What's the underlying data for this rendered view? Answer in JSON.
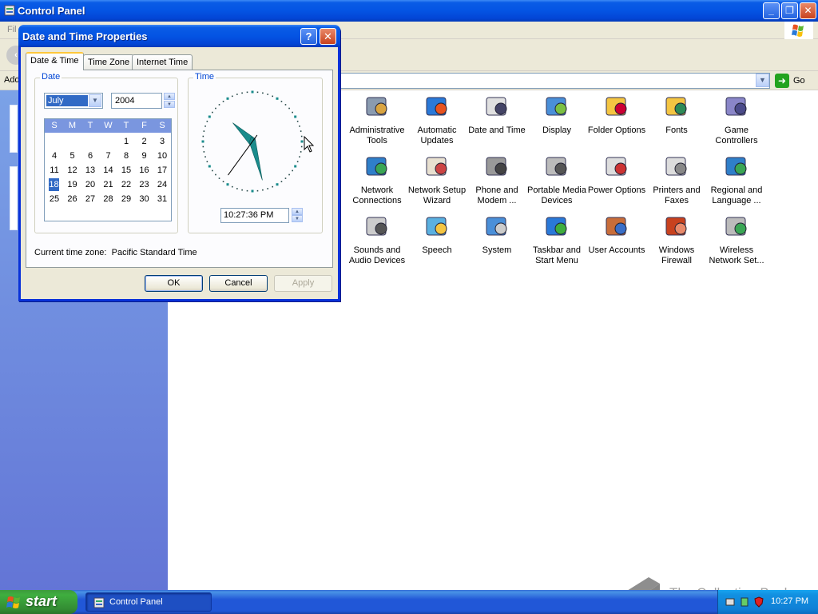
{
  "window": {
    "title": "Control Panel",
    "menu_file": "Fil",
    "address_label": "Add",
    "go_label": "Go"
  },
  "control_panel_items": [
    {
      "label": "Administrative Tools",
      "icon": "administrative-tools-icon"
    },
    {
      "label": "Automatic Updates",
      "icon": "automatic-updates-icon"
    },
    {
      "label": "Date and Time",
      "icon": "date-and-time-icon"
    },
    {
      "label": "Display",
      "icon": "display-icon"
    },
    {
      "label": "Folder Options",
      "icon": "folder-options-icon"
    },
    {
      "label": "Fonts",
      "icon": "fonts-icon"
    },
    {
      "label": "Game Controllers",
      "icon": "game-controllers-icon"
    },
    {
      "label": "Network Connections",
      "icon": "network-connections-icon"
    },
    {
      "label": "Network Setup Wizard",
      "icon": "network-setup-wizard-icon"
    },
    {
      "label": "Phone and Modem ...",
      "icon": "phone-and-modem-icon"
    },
    {
      "label": "Portable Media Devices",
      "icon": "portable-media-devices-icon"
    },
    {
      "label": "Power Options",
      "icon": "power-options-icon"
    },
    {
      "label": "Printers and Faxes",
      "icon": "printers-and-faxes-icon"
    },
    {
      "label": "Regional and Language ...",
      "icon": "regional-language-icon"
    },
    {
      "label": "Sounds and Audio Devices",
      "icon": "sounds-audio-icon"
    },
    {
      "label": "Speech",
      "icon": "speech-icon"
    },
    {
      "label": "System",
      "icon": "system-icon"
    },
    {
      "label": "Taskbar and Start Menu",
      "icon": "taskbar-start-menu-icon"
    },
    {
      "label": "User Accounts",
      "icon": "user-accounts-icon"
    },
    {
      "label": "Windows Firewall",
      "icon": "windows-firewall-icon"
    },
    {
      "label": "Wireless Network Set...",
      "icon": "wireless-network-icon"
    }
  ],
  "dialog": {
    "title": "Date and Time Properties",
    "help_glyph": "?",
    "close_glyph": "✕",
    "tabs": [
      {
        "label": "Date & Time",
        "active": true
      },
      {
        "label": "Time Zone",
        "active": false
      },
      {
        "label": "Internet Time",
        "active": false
      }
    ],
    "date_group_label": "Date",
    "time_group_label": "Time",
    "month": "July",
    "year": "2004",
    "weekdays": [
      "S",
      "M",
      "T",
      "W",
      "T",
      "F",
      "S"
    ],
    "calendar_weeks": [
      [
        "",
        "",
        "",
        "",
        "1",
        "2",
        "3"
      ],
      [
        "4",
        "5",
        "6",
        "7",
        "8",
        "9",
        "10"
      ],
      [
        "11",
        "12",
        "13",
        "14",
        "15",
        "16",
        "17"
      ],
      [
        "18",
        "19",
        "20",
        "21",
        "22",
        "23",
        "24"
      ],
      [
        "25",
        "26",
        "27",
        "28",
        "29",
        "30",
        "31"
      ]
    ],
    "selected_day": "18",
    "time_value": "10:27:36 PM",
    "clock": {
      "hour": 10,
      "minute": 27,
      "second": 36
    },
    "timezone_label": "Current time zone:",
    "timezone_value": "Pacific Standard Time",
    "buttons": {
      "ok": "OK",
      "cancel": "Cancel",
      "apply": "Apply"
    }
  },
  "taskbar": {
    "start_label": "start",
    "task_label": "Control Panel",
    "clock": "10:27 PM"
  },
  "watermark": "The Collection Book",
  "colors": {
    "titlebar_blue": "#0454e3",
    "taskbar_blue": "#2157d7",
    "start_green": "#3fae3f",
    "selection_blue": "#316ac5",
    "clock_hand_teal": "#1a8c8c"
  }
}
